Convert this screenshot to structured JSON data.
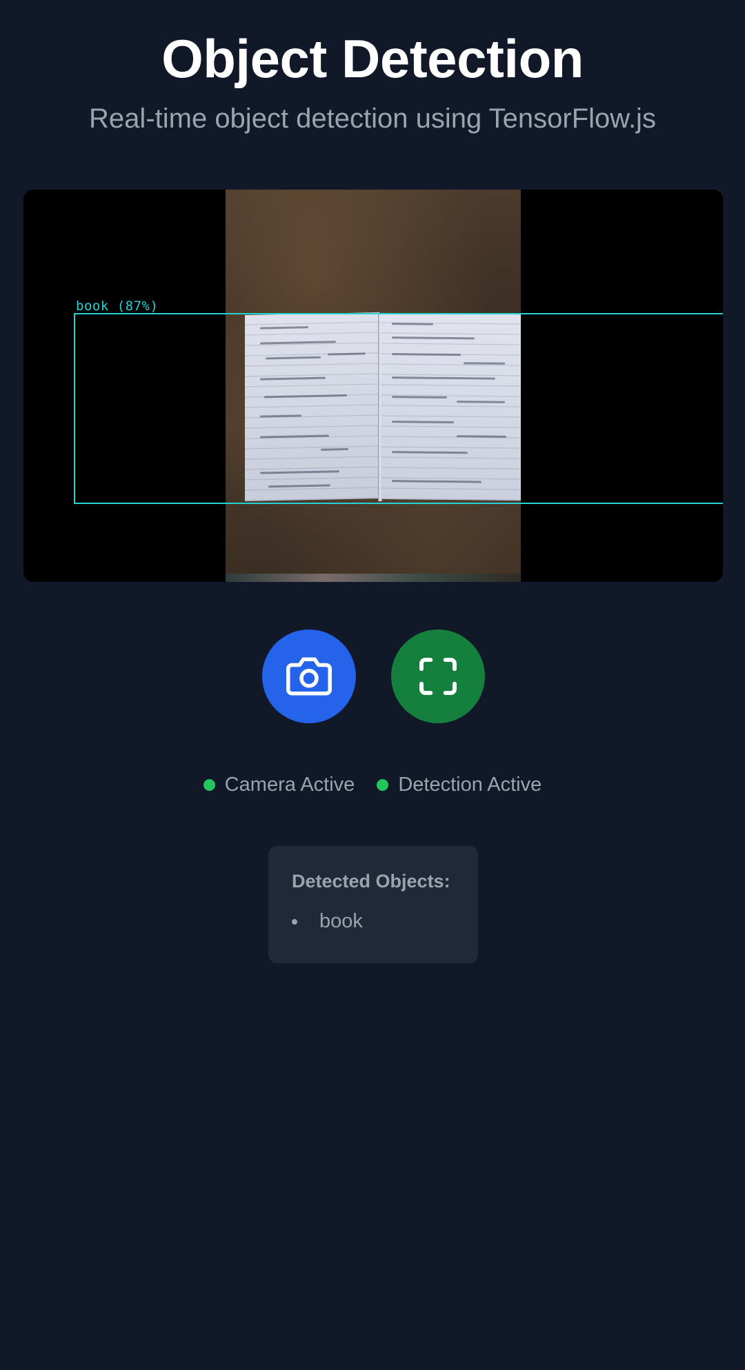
{
  "header": {
    "title": "Object Detection",
    "subtitle": "Real-time object detection using TensorFlow.js"
  },
  "video": {
    "detection_label": "book (87%)",
    "box_color": "#22d3d1"
  },
  "controls": {
    "camera_button_icon": "camera-icon",
    "camera_button_color": "#2563eb",
    "fullscreen_button_icon": "scan-frame-icon",
    "fullscreen_button_color": "#15803d"
  },
  "status": {
    "dot_color": "#22c55e",
    "camera": "Camera Active",
    "detection": "Detection Active"
  },
  "detected": {
    "title": "Detected Objects:",
    "items": [
      "book"
    ]
  },
  "colors": {
    "background": "#111827",
    "card": "#1f2937",
    "muted_text": "#9ca3af"
  }
}
